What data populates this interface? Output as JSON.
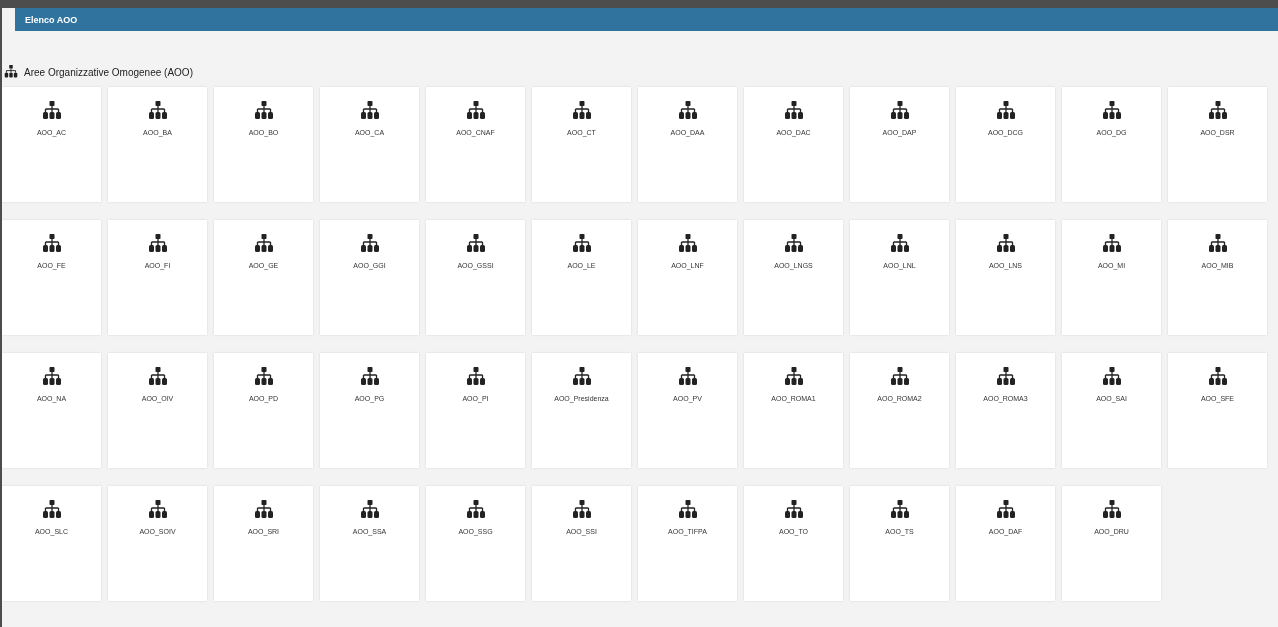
{
  "header": {
    "title": "Elenco AOO"
  },
  "section": {
    "title": "Aree Organizzative Omogenee (AOO)"
  },
  "cards": [
    {
      "label": "AOO_AC"
    },
    {
      "label": "AOO_BA"
    },
    {
      "label": "AOO_BO"
    },
    {
      "label": "AOO_CA"
    },
    {
      "label": "AOO_CNAF"
    },
    {
      "label": "AOO_CT"
    },
    {
      "label": "AOO_DAA"
    },
    {
      "label": "AOO_DAC"
    },
    {
      "label": "AOO_DAP"
    },
    {
      "label": "AOO_DCG"
    },
    {
      "label": "AOO_DG"
    },
    {
      "label": "AOO_DSR"
    },
    {
      "label": "AOO_FE"
    },
    {
      "label": "AOO_FI"
    },
    {
      "label": "AOO_GE"
    },
    {
      "label": "AOO_GGI"
    },
    {
      "label": "AOO_GSSI"
    },
    {
      "label": "AOO_LE"
    },
    {
      "label": "AOO_LNF"
    },
    {
      "label": "AOO_LNGS"
    },
    {
      "label": "AOO_LNL"
    },
    {
      "label": "AOO_LNS"
    },
    {
      "label": "AOO_MI"
    },
    {
      "label": "AOO_MIB"
    },
    {
      "label": "AOO_NA"
    },
    {
      "label": "AOO_OIV"
    },
    {
      "label": "AOO_PD"
    },
    {
      "label": "AOO_PG"
    },
    {
      "label": "AOO_PI"
    },
    {
      "label": "AOO_Presidenza"
    },
    {
      "label": "AOO_PV"
    },
    {
      "label": "AOO_ROMA1"
    },
    {
      "label": "AOO_ROMA2"
    },
    {
      "label": "AOO_ROMA3"
    },
    {
      "label": "AOO_SAI"
    },
    {
      "label": "AOO_SFE"
    },
    {
      "label": "AOO_SLC"
    },
    {
      "label": "AOO_SOIV"
    },
    {
      "label": "AOO_SRI"
    },
    {
      "label": "AOO_SSA"
    },
    {
      "label": "AOO_SSG"
    },
    {
      "label": "AOO_SSI"
    },
    {
      "label": "AOO_TIFPA"
    },
    {
      "label": "AOO_TO"
    },
    {
      "label": "AOO_TS"
    },
    {
      "label": "AOO_DAF"
    },
    {
      "label": "AOO_DRU"
    }
  ]
}
